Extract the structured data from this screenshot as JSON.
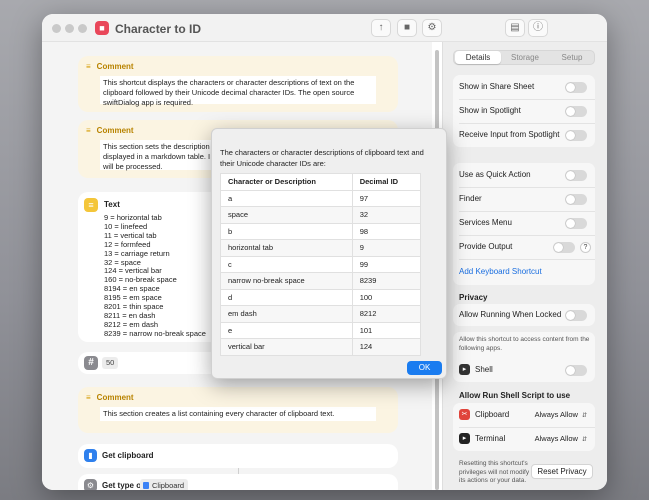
{
  "window": {
    "title": "Character to ID"
  },
  "editor": {
    "comment1": {
      "label": "Comment",
      "text": "This shortcut displays the characters or character descriptions of text on the clipboard followed by their Unicode decimal character IDs. The open source swiftDialog app is required."
    },
    "comment2": {
      "label": "Comment",
      "lines": [
        "This section sets the description",
        "displayed in a markdown table. I",
        "will be processed."
      ]
    },
    "text_action": {
      "label": "Text",
      "lines": [
        "9 = horizontal tab",
        "10 = linefeed",
        "11 = vertical tab",
        "12 = formfeed",
        "13 = carriage return",
        "32 = space",
        "124 = vertical bar",
        "160 = no-break space",
        "8194 = en space",
        "8195 = em space",
        "8201 = thin space",
        "8211 = en dash",
        "8212 = em dash",
        "8239 = narrow no-break space"
      ]
    },
    "number_action": {
      "value": "50"
    },
    "comment3": {
      "label": "Comment",
      "text": "This section creates a list containing every character of clipboard text."
    },
    "get_clipboard": {
      "label": "Get clipboard"
    },
    "get_type": {
      "label": "Get type of",
      "chip": "Clipboard"
    }
  },
  "panel": {
    "tabs": [
      "Details",
      "Storage",
      "Setup"
    ],
    "group1": [
      "Show in Share Sheet",
      "Show in Spotlight",
      "Receive Input from Spotlight"
    ],
    "group2": [
      "Use as Quick Action",
      "Finder",
      "Services Menu",
      "Provide Output"
    ],
    "help": "?",
    "keyboard_shortcut": "Add Keyboard Shortcut",
    "privacy": {
      "heading": "Privacy",
      "allow_locked": "Allow Running When Locked",
      "note": "Allow this shortcut to access content from the following apps.",
      "shell": "Shell",
      "run_shell_heading": "Allow Run Shell Script to use",
      "clipboard": {
        "label": "Clipboard",
        "value": "Always Allow"
      },
      "terminal": {
        "label": "Terminal",
        "value": "Always Allow"
      },
      "reset_note": "Resetting this shortcut's privileges will not modify its actions or your data.",
      "reset_button": "Reset Privacy"
    }
  },
  "dialog": {
    "message": "The characters or character descriptions of clipboard text and their Unicode character IDs are:",
    "headers": [
      "Character or Description",
      "Decimal ID"
    ],
    "rows": [
      [
        "a",
        "97"
      ],
      [
        "space",
        "32"
      ],
      [
        "b",
        "98"
      ],
      [
        "horizontal tab",
        "9"
      ],
      [
        "c",
        "99"
      ],
      [
        "narrow no-break space",
        "8239"
      ],
      [
        "d",
        "100"
      ],
      [
        "em dash",
        "8212"
      ],
      [
        "e",
        "101"
      ],
      [
        "vertical bar",
        "124"
      ]
    ],
    "ok_label": "OK"
  },
  "colors": {
    "accent": "#1a7cf0",
    "comment_bg": "#fbf4e2",
    "text_icon": "#f4c63a"
  }
}
